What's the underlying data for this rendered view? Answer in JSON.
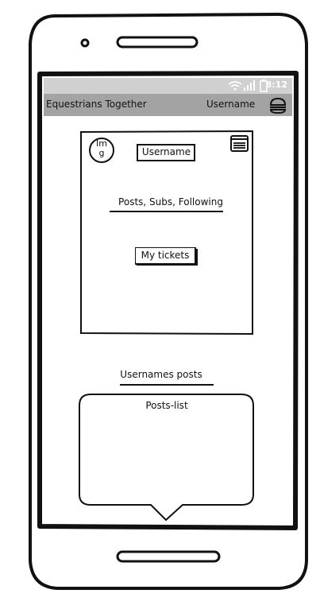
{
  "status": {
    "time": "8:12"
  },
  "app": {
    "title": "Equestrians Together",
    "username": "Username"
  },
  "profile": {
    "avatar_text_line1": "Im",
    "avatar_text_line2": "g",
    "username_button": "Username",
    "stats": "Posts, Subs, Following",
    "tickets_button": "My tickets"
  },
  "posts": {
    "heading": "Usernames posts",
    "list_label": "Posts-list"
  },
  "icons": {
    "wifi": "wifi-icon",
    "signal": "signal-icon",
    "battery": "battery-icon",
    "menu": "hamburger-icon",
    "card": "card-menu-icon"
  }
}
